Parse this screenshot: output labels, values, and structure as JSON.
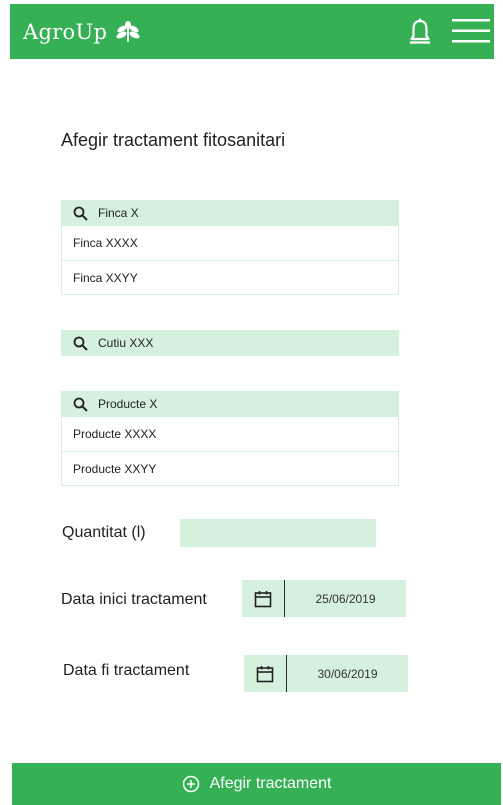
{
  "header": {
    "logo_text": "AgroUp",
    "logo_icon": "leaf-icon",
    "notification_icon": "bell-icon",
    "menu_icon": "hamburger-menu-icon",
    "color": "#35b055"
  },
  "page_title": "Afegir tractament fitosanitari",
  "finca": {
    "search_value": "Finca X",
    "results": [
      "Finca XXXX",
      "Finca XXYY"
    ]
  },
  "cutiu": {
    "search_value": "Cutiu XXX"
  },
  "producte": {
    "search_value": "Producte X",
    "results": [
      "Producte XXXX",
      "Producte XXYY"
    ]
  },
  "quantitat": {
    "label": "Quantitat (l)",
    "value": ""
  },
  "data_inici": {
    "label": "Data inici tractament",
    "value": "25/06/2019"
  },
  "data_fi": {
    "label": "Data fi tractament",
    "value": "30/06/2019"
  },
  "submit": {
    "label": "Afegir tractament",
    "icon": "plus-circle-icon"
  },
  "colors": {
    "accent": "#35b055",
    "field_bg": "#d6f0de"
  }
}
